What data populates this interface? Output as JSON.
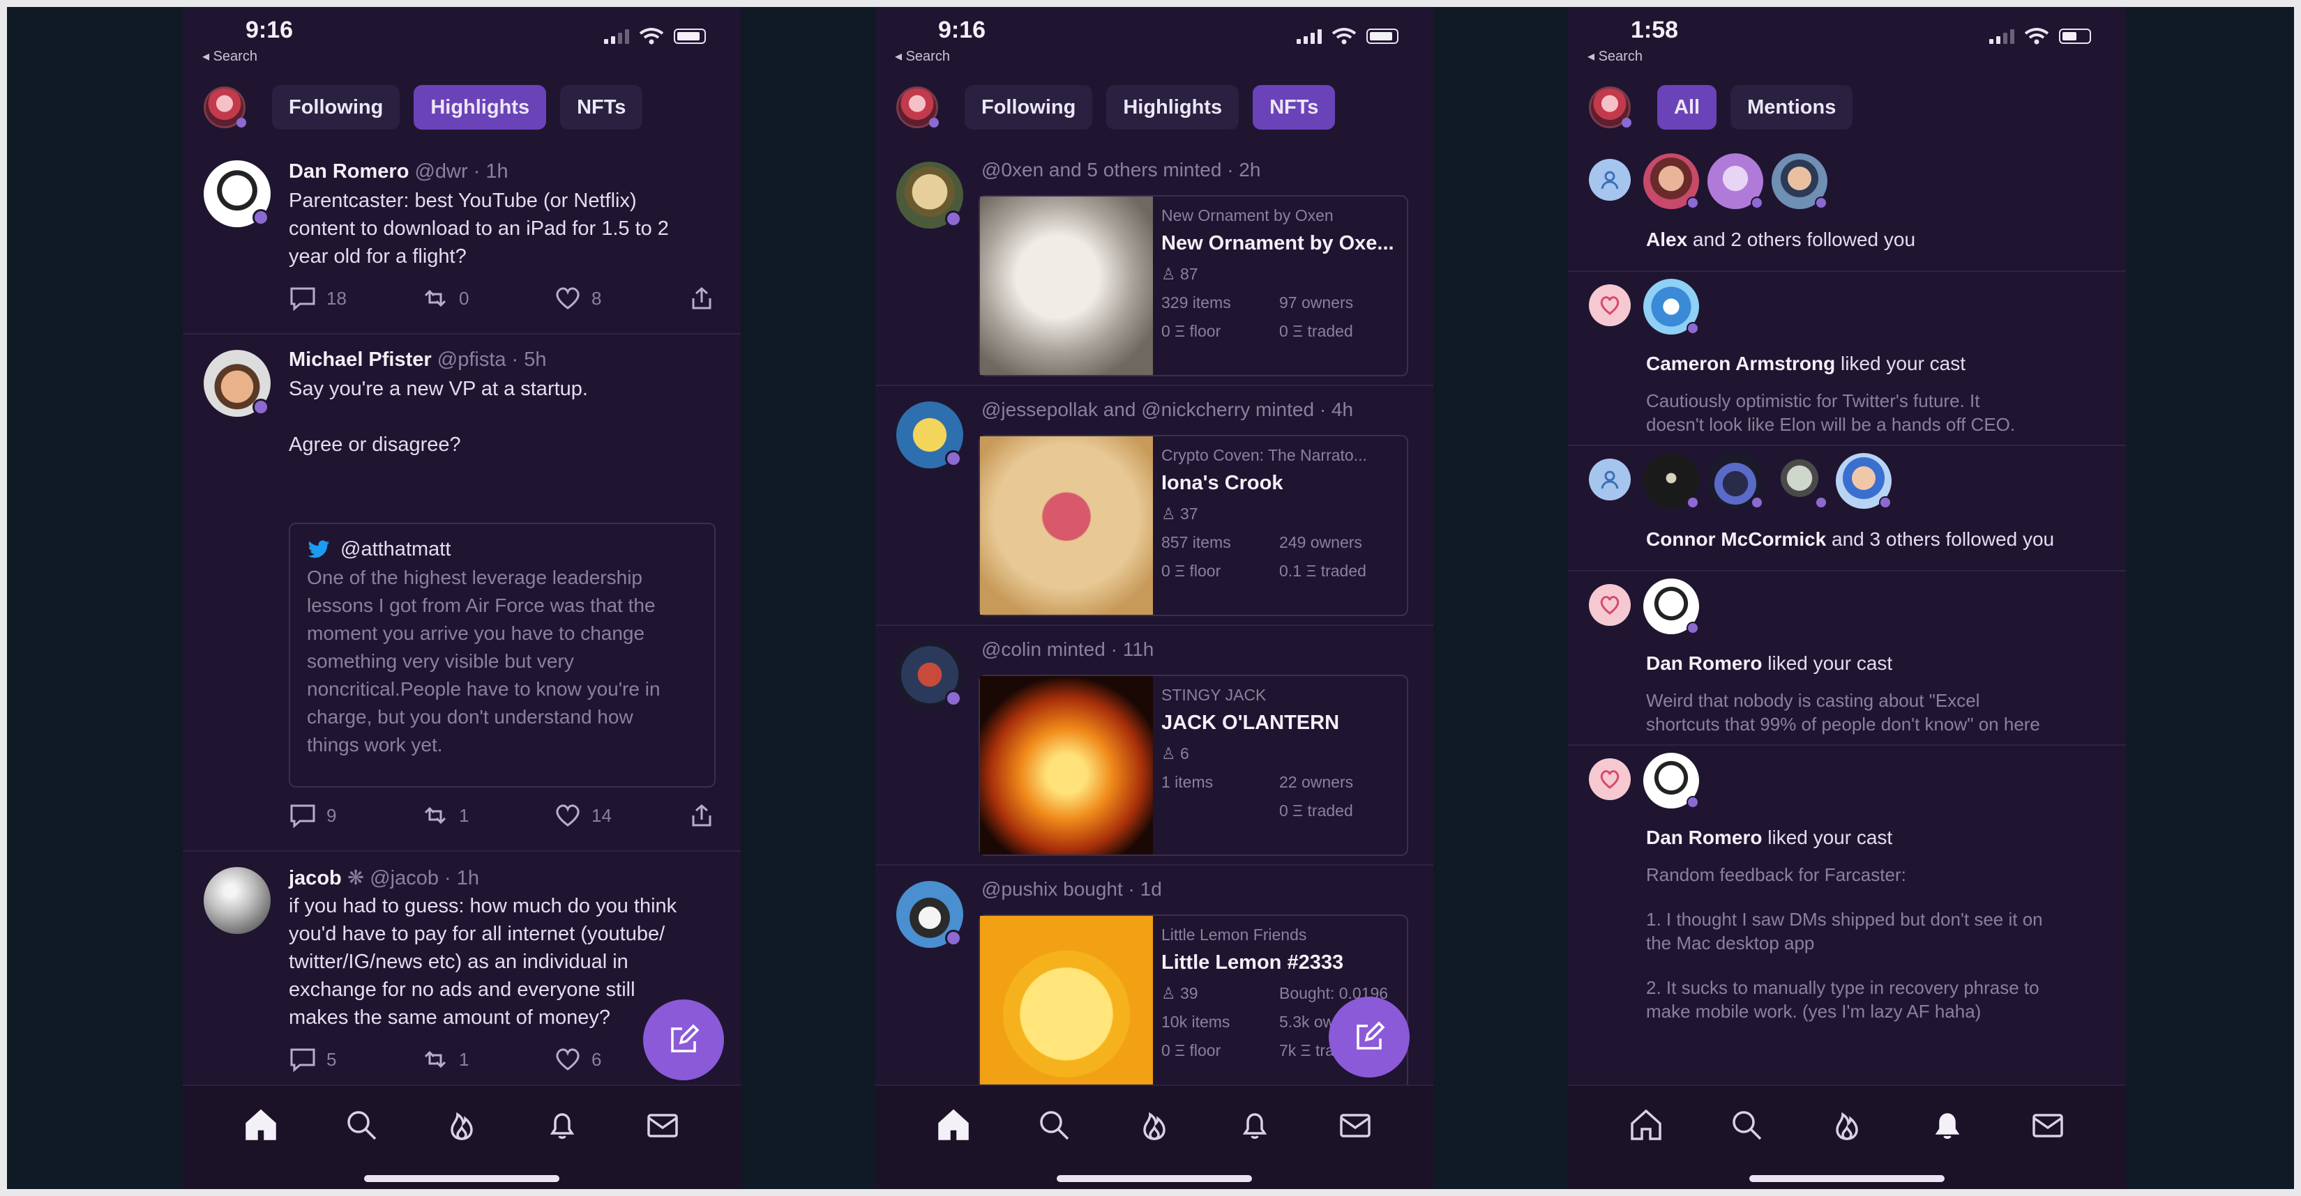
{
  "phones": [
    {
      "status": {
        "time": "9:16",
        "back": "◂ Search"
      },
      "tabs": [
        "Following",
        "Highlights",
        "NFTs"
      ],
      "posts": [
        {
          "name": "Dan Romero",
          "meta": "@dwr · 1h",
          "lines": [
            "Parentcaster: best YouTube (or Netflix)",
            "content to download to an iPad for 1.5 to 2",
            "year old for a flight?"
          ],
          "replies": "18",
          "recasts": "0",
          "likes": "8"
        },
        {
          "name": "Michael Pfister",
          "meta": "@pfista · 5h",
          "lines": [
            "Say you're a new VP at a startup.",
            "",
            "Agree or disagree?"
          ],
          "quote_handle": "@atthatmatt",
          "quote_lines": [
            "One of the highest leverage leadership",
            "lessons I got from Air Force was that the",
            "moment you arrive you have to change",
            "something very visible but very",
            "noncritical.People have to know you're in",
            "charge, but you don't understand how",
            "things work yet."
          ],
          "replies": "9",
          "recasts": "1",
          "likes": "14"
        },
        {
          "name": "jacob",
          "badge": "❋",
          "meta": "@jacob · 1h",
          "lines": [
            "if you had to guess: how much do you think",
            "you'd have to pay for all internet (youtube/",
            "twitter/IG/news etc) as an individual in",
            "exchange for no ads and everyone still",
            "makes the same amount of money?"
          ],
          "replies": "5",
          "recasts": "1",
          "likes": "6"
        }
      ]
    },
    {
      "status": {
        "time": "9:16",
        "back": "◂ Search"
      },
      "tabs": [
        "Following",
        "Highlights",
        "NFTs"
      ],
      "nfts": [
        {
          "head": "@0xen and 5 others minted · 2h",
          "collection": "New Ornament by Oxen",
          "title": "New Ornament by Oxe...",
          "holders": "87",
          "items": "329 items",
          "owners": "97 owners",
          "floor": "0 Ξ floor",
          "traded": "0 Ξ traded"
        },
        {
          "head": "@jessepollak and @nickcherry minted · 4h",
          "collection": "Crypto Coven: The Narrato...",
          "title": "Iona's Crook",
          "holders": "37",
          "items": "857 items",
          "owners": "249 owners",
          "floor": "0 Ξ floor",
          "traded": "0.1 Ξ traded"
        },
        {
          "head": "@colin minted · 11h",
          "collection": "STINGY JACK",
          "title": "JACK O'LANTERN",
          "holders": "6",
          "items": "1 items",
          "owners": "22 owners",
          "floor": "",
          "traded": "0 Ξ traded"
        },
        {
          "head": "@pushix bought · 1d",
          "collection": "Little Lemon Friends",
          "title": "Little Lemon #2333",
          "holders": "39",
          "bought": "Bought:",
          "price": "0.0196",
          "items": "10k items",
          "owners": "5.3k ow...",
          "floor": "0 Ξ floor",
          "traded": "7k Ξ traded"
        }
      ]
    },
    {
      "status": {
        "time": "1:58",
        "back": "◂ Search"
      },
      "tabs": [
        "All",
        "Mentions"
      ],
      "notifs": [
        {
          "type": "follow",
          "bold": "Alex",
          "rest": " and 2 others followed you"
        },
        {
          "type": "like",
          "bold": "Cameron Armstrong",
          "rest": " liked your cast",
          "sub": [
            "Cautiously optimistic for Twitter's future. It",
            "doesn't look like Elon will be a hands off CEO."
          ]
        },
        {
          "type": "follow",
          "bold": "Connor McCormick",
          "rest": " and 3 others followed you"
        },
        {
          "type": "like",
          "bold": "Dan Romero",
          "rest": " liked your cast",
          "sub": [
            "Weird that nobody is casting about \"Excel",
            "shortcuts that 99% of people don't know\" on here"
          ]
        },
        {
          "type": "like",
          "bold": "Dan Romero",
          "rest": " liked your cast",
          "sub": [
            "Random feedback for Farcaster:",
            "",
            "1. I thought I saw DMs shipped but don't see it on",
            "the Mac desktop app",
            "",
            "2. It sucks to manually type in recovery phrase to",
            "make mobile work. (yes I'm lazy AF haha)"
          ]
        }
      ]
    }
  ],
  "colors": {
    "background": "#0f1a24",
    "phone": "#1f1530",
    "accent": "#6b43b8",
    "fab": "#8b5ad9"
  },
  "icons": [
    "home-icon",
    "search-icon",
    "flame-icon",
    "bell-icon",
    "inbox-icon",
    "compose-icon",
    "reply-icon",
    "recast-icon",
    "heart-icon",
    "share-icon",
    "twitter-bird-icon",
    "follow-person-icon",
    "like-heart-icon"
  ]
}
